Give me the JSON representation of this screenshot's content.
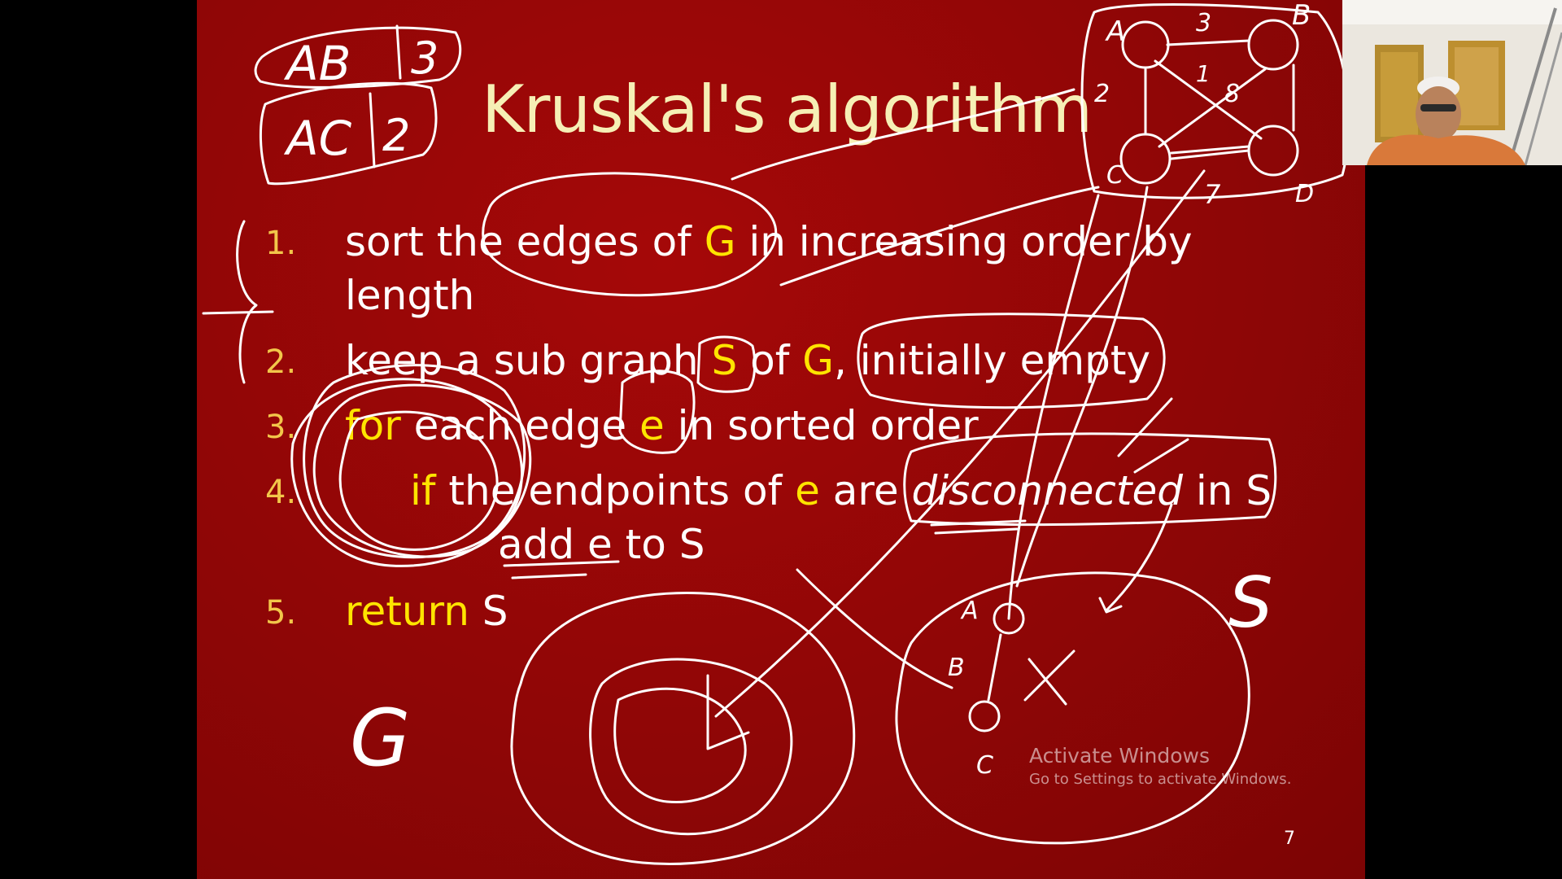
{
  "slide": {
    "title": "Kruskal's algorithm",
    "steps": [
      {
        "num": "1.",
        "text_a": "sort the edges of ",
        "hl_a": "G",
        "text_b": " in increasing order by",
        "line2": "length"
      },
      {
        "num": "2.",
        "text_a": "keep a sub graph ",
        "hl_a": "S",
        "text_b": " of ",
        "hl_b": "G",
        "text_c": ", initially empty"
      },
      {
        "num": "3.",
        "hl_a": "for",
        "text_a": " each edge ",
        "hl_b": "e",
        "text_b": " in sorted order"
      },
      {
        "num": "4.",
        "hl_a": "if",
        "text_a": " the endpoints of ",
        "hl_b": "e",
        "text_b": " are ",
        "italic": "disconnected",
        "text_c": " in S",
        "line2": "add e to S"
      },
      {
        "num": "5.",
        "hl_a": "return",
        "text_a": " S"
      }
    ],
    "slide_number": "7"
  },
  "annotations": {
    "edge_table": [
      [
        "AB",
        "3"
      ],
      [
        "AC",
        "2"
      ]
    ],
    "graph_top": {
      "nodes": [
        "A",
        "B",
        "C",
        "D"
      ],
      "edge_weights": [
        "3",
        "2",
        "8",
        "7",
        "1"
      ]
    },
    "graph_bottom": {
      "nodes": [
        "A",
        "B",
        "C"
      ]
    },
    "labels": {
      "g_circle": "G",
      "s_circle": "S"
    }
  },
  "watermark": {
    "title": "Activate Windows",
    "subtitle": "Go to Settings to activate Windows."
  },
  "colors": {
    "slide_bg": "#9a0707",
    "title": "#f6efb5",
    "highlight": "#ffe400",
    "number": "#f2c64a",
    "ink": "#ffffff"
  }
}
